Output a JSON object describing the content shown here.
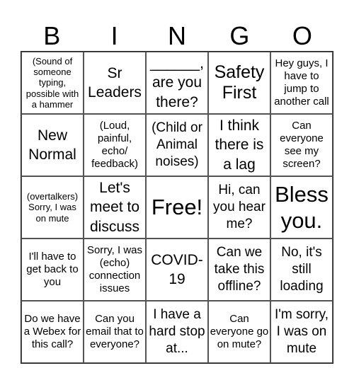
{
  "header": {
    "letters": [
      "B",
      "I",
      "N",
      "G",
      "O"
    ]
  },
  "board": {
    "rows": [
      [
        {
          "text": "(Sound of someone typing, possible with a hammer",
          "size": "xs"
        },
        {
          "text": "Sr Leaders",
          "size": "l"
        },
        {
          "text": "______, are you there?",
          "size": "l"
        },
        {
          "text": "Safety First",
          "size": "xl"
        },
        {
          "text": "Hey guys, I have to jump to another call",
          "size": "s"
        }
      ],
      [
        {
          "text": "New Normal",
          "size": "l"
        },
        {
          "text": "(Loud, painful, echo/ feedback)",
          "size": "s"
        },
        {
          "text": "(Child or Animal noises)",
          "size": "m"
        },
        {
          "text": "I think there is a lag",
          "size": "l"
        },
        {
          "text": "Can everyone see my screen?",
          "size": "s"
        }
      ],
      [
        {
          "text": "(overtalkers) Sorry, I was on mute",
          "size": "xs"
        },
        {
          "text": "Let's meet to discuss",
          "size": "l"
        },
        {
          "text": "Free!",
          "size": "xxl"
        },
        {
          "text": "Hi, can you hear me?",
          "size": "m"
        },
        {
          "text": "Bless you.",
          "size": "xxl"
        }
      ],
      [
        {
          "text": "I'll have to get back to you",
          "size": "s"
        },
        {
          "text": "Sorry, I was (echo) connection issues",
          "size": "s"
        },
        {
          "text": "COVID-19",
          "size": "l"
        },
        {
          "text": "Can we take this offline?",
          "size": "m"
        },
        {
          "text": "No, it's still loading",
          "size": "m"
        }
      ],
      [
        {
          "text": "Do we have a Webex for this call?",
          "size": "s"
        },
        {
          "text": "Can you email that to everyone?",
          "size": "s"
        },
        {
          "text": "I have a hard stop at...",
          "size": "m"
        },
        {
          "text": "Can everyone go on mute?",
          "size": "s"
        },
        {
          "text": "I'm sorry, I was on mute",
          "size": "m"
        }
      ]
    ]
  }
}
